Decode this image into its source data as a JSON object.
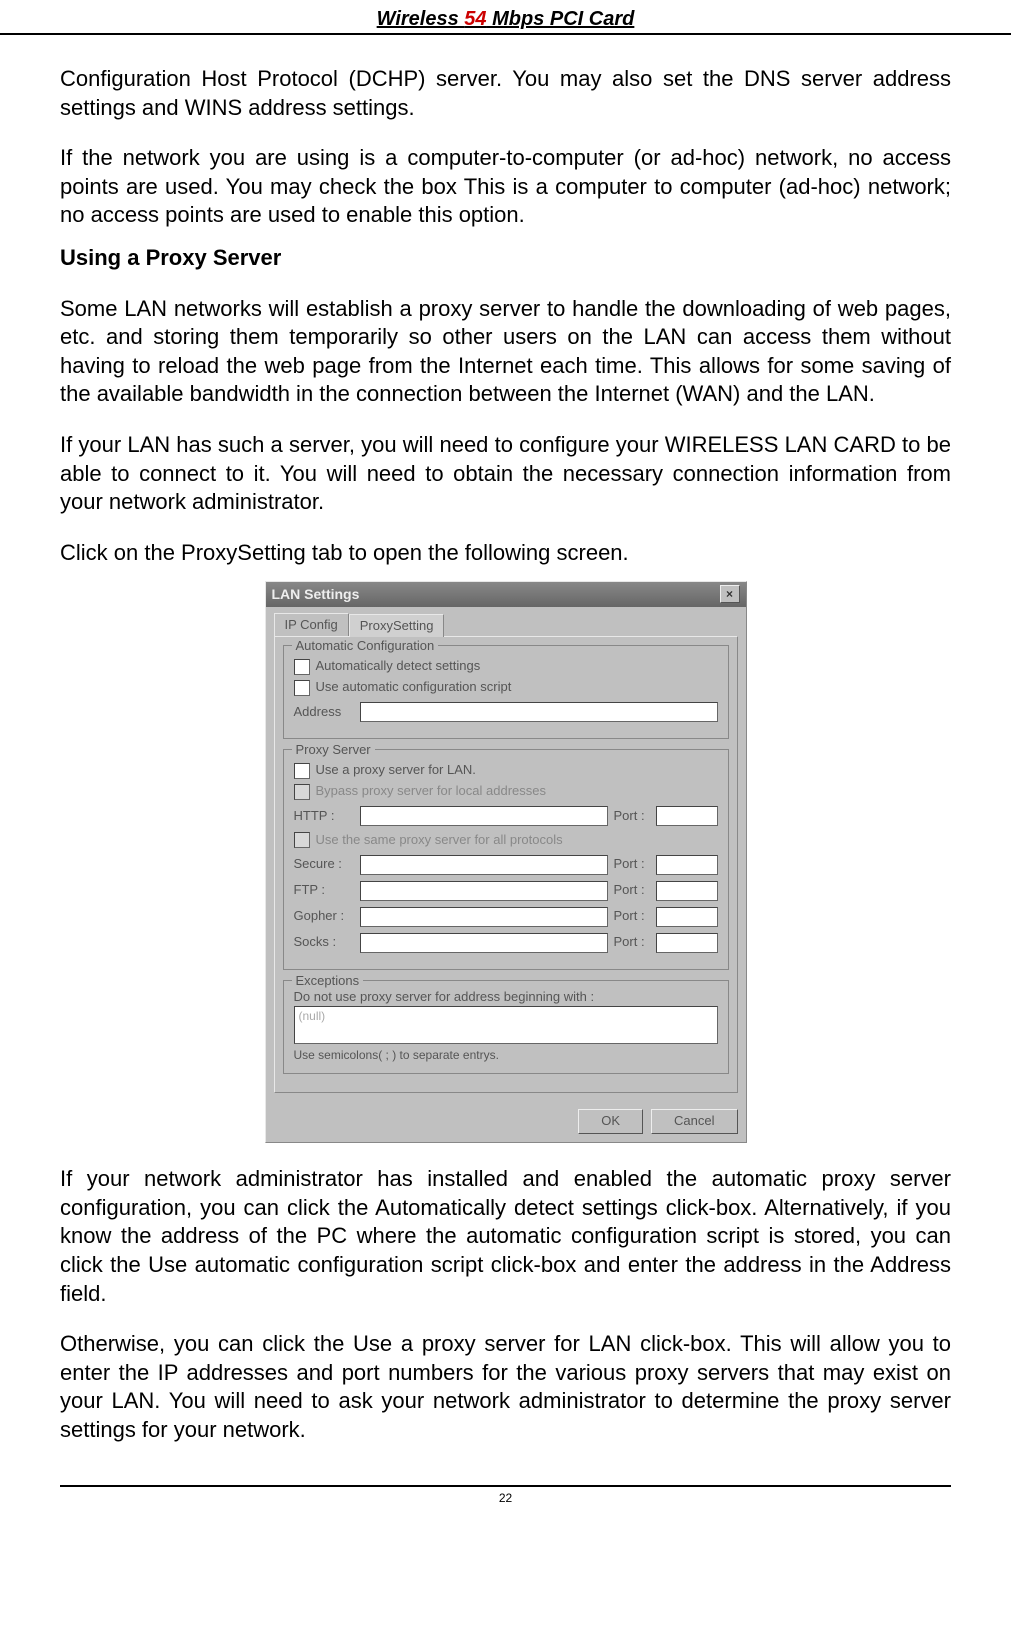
{
  "header": {
    "prefix": "Wireless ",
    "red": "54",
    "suffix": " Mbps PCI Card"
  },
  "paras": {
    "p1": "Configuration Host Protocol (DCHP) server. You may also set the DNS server address settings and WINS address settings.",
    "p2": "If the network you are using is a computer-to-computer (or ad-hoc) network, no access points are used. You may check the box This is a computer to computer (ad-hoc) network; no access points are used to enable this option.",
    "h1": "Using a Proxy Server",
    "p3": "Some LAN networks will establish a proxy server to handle the downloading of web pages, etc. and storing them temporarily so other users on the LAN can access them without having to reload the web page from the Internet each time.  This allows for some saving of the available bandwidth in the connection between the Internet (WAN) and the LAN.",
    "p4": "If your LAN has such a server, you will need to configure your WIRELESS LAN CARD to be able to connect to it.  You will need to obtain the necessary connection information from your network administrator.",
    "p5": "Click on the ProxySetting tab to open the following screen.",
    "p6": "If your network administrator has installed and enabled the automatic proxy server configuration, you can click the Automatically detect settings click-box.  Alternatively, if you know the address of the PC where the automatic configuration script is stored, you can click the Use automatic configuration script click-box and enter the address in the Address field.",
    "p7": "Otherwise, you can click the Use a proxy server for LAN click-box.  This will allow you to enter the IP addresses and port numbers for the various proxy servers that may exist on your LAN.  You will need to ask your network administrator to determine the proxy server settings for your network."
  },
  "dialog": {
    "title": "LAN Settings",
    "tabs": {
      "ip": "IP Config",
      "proxy": "ProxySetting"
    },
    "auto": {
      "legend": "Automatic Configuration",
      "detect": "Automatically detect settings",
      "script": "Use automatic configuration script",
      "addressLabel": "Address"
    },
    "proxy": {
      "legend": "Proxy Server",
      "useProxy": "Use a proxy server for LAN.",
      "bypass": "Bypass proxy server for local addresses",
      "sameAll": "Use the same proxy server for all protocols",
      "portLabel": "Port :",
      "rows": {
        "http": "HTTP :",
        "secure": "Secure :",
        "ftp": "FTP :",
        "gopher": "Gopher :",
        "socks": "Socks :"
      }
    },
    "exc": {
      "legend": "Exceptions",
      "label": "Do not use proxy server for address beginning with :",
      "placeholder": "(null)",
      "hint": "Use semicolons( ; ) to separate entrys."
    },
    "buttons": {
      "ok": "OK",
      "cancel": "Cancel"
    }
  },
  "footer": {
    "page": "22"
  }
}
